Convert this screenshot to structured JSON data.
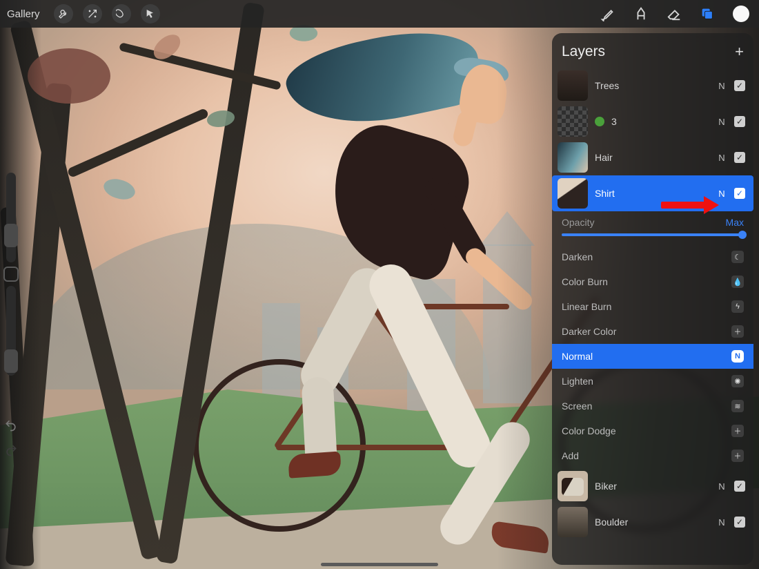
{
  "topbar": {
    "gallery_label": "Gallery",
    "left_tools": [
      "wrench-icon",
      "wand-icon",
      "select-icon",
      "pointer-icon"
    ],
    "right_tools": [
      "brush-icon",
      "smudge-icon",
      "eraser-icon",
      "layers-icon",
      "color-swatch"
    ],
    "active_right_tool": "layers-icon",
    "swatch_color": "#f8f8f8"
  },
  "sidebar": {
    "undo_icon": "undo-icon",
    "redo_icon": "redo-icon"
  },
  "layers_panel": {
    "title": "Layers",
    "add_label": "+",
    "opacity_label": "Opacity",
    "opacity_value_label": "Max",
    "selected_layer": "Shirt",
    "selected_blend_mode": "Normal",
    "layers": [
      {
        "name": "Trees",
        "blend": "N",
        "visible": true,
        "thumb": "th-trees",
        "selected": false,
        "group_badge": null
      },
      {
        "name": "3",
        "blend": "N",
        "visible": true,
        "thumb": "checker",
        "selected": false,
        "group_badge": "green"
      },
      {
        "name": "Hair",
        "blend": "N",
        "visible": true,
        "thumb": "th-hair",
        "selected": false,
        "group_badge": null
      },
      {
        "name": "Shirt",
        "blend": "N",
        "visible": true,
        "thumb": "th-shirt",
        "selected": true,
        "group_badge": null
      },
      {
        "name": "Biker",
        "blend": "N",
        "visible": true,
        "thumb": "th-biker",
        "selected": false,
        "group_badge": null
      },
      {
        "name": "Boulder",
        "blend": "N",
        "visible": true,
        "thumb": "th-boulder",
        "selected": false,
        "group_badge": null
      }
    ],
    "blend_modes": [
      {
        "name": "Darken",
        "icon": "moon-icon"
      },
      {
        "name": "Color Burn",
        "icon": "drop-icon"
      },
      {
        "name": "Linear Burn",
        "icon": "flame-icon"
      },
      {
        "name": "Darker Color",
        "icon": "plus-circle-icon"
      },
      {
        "name": "Normal",
        "icon": "n-badge-icon",
        "selected": true
      },
      {
        "name": "Lighten",
        "icon": "sun-icon"
      },
      {
        "name": "Screen",
        "icon": "lines-icon"
      },
      {
        "name": "Color Dodge",
        "icon": "plus-circle-icon"
      },
      {
        "name": "Add",
        "icon": "plus-square-icon"
      }
    ]
  },
  "annotation": {
    "target": "selected-layer-blend-indicator"
  }
}
